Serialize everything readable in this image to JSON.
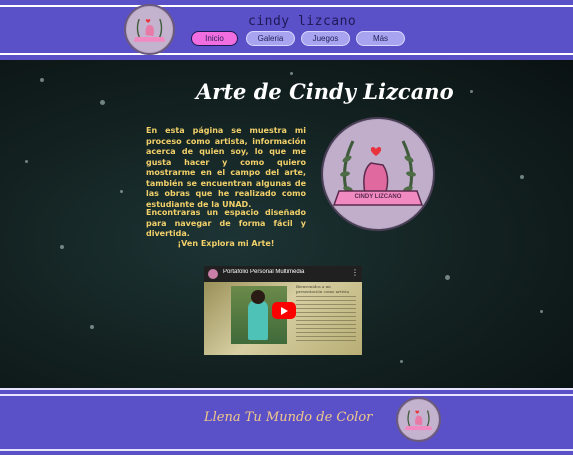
{
  "header": {
    "site_title": "cindy lizcano",
    "logo_icon": "cindy-lizcano-logo-icon",
    "nav": [
      {
        "label": "Inicio",
        "active": true
      },
      {
        "label": "Galeria",
        "active": false
      },
      {
        "label": "Juegos",
        "active": false
      },
      {
        "label": "Más",
        "active": false
      }
    ]
  },
  "main": {
    "title": "Arte de Cindy Lizcano",
    "paragraph1": "En esta página se muestra mi proceso como artista, información acerca de quien soy, lo que me gusta hacer y como quiero mostrarme en el campo del arte, también se encuentran algunas de las obras que he realizado como estudiante de la UNAD.",
    "paragraph2": "Encontraras un espacio diseñado para navegar de forma fácil y divertida.",
    "cta": "¡Ven Explora mi Arte!",
    "badge_text": "CINDY LIZCANO",
    "video": {
      "title": "Portafolio Personal Multimedia",
      "doc_heading": "Bienvenidos a mi presentación como artista"
    }
  },
  "footer": {
    "slogan": "Llena Tu Mundo de Color"
  },
  "colors": {
    "header_bg": "#5a50c8",
    "nav_active": "#f06ee0",
    "nav_inactive": "#a9a4f0",
    "text_gold": "#f2d06a"
  }
}
